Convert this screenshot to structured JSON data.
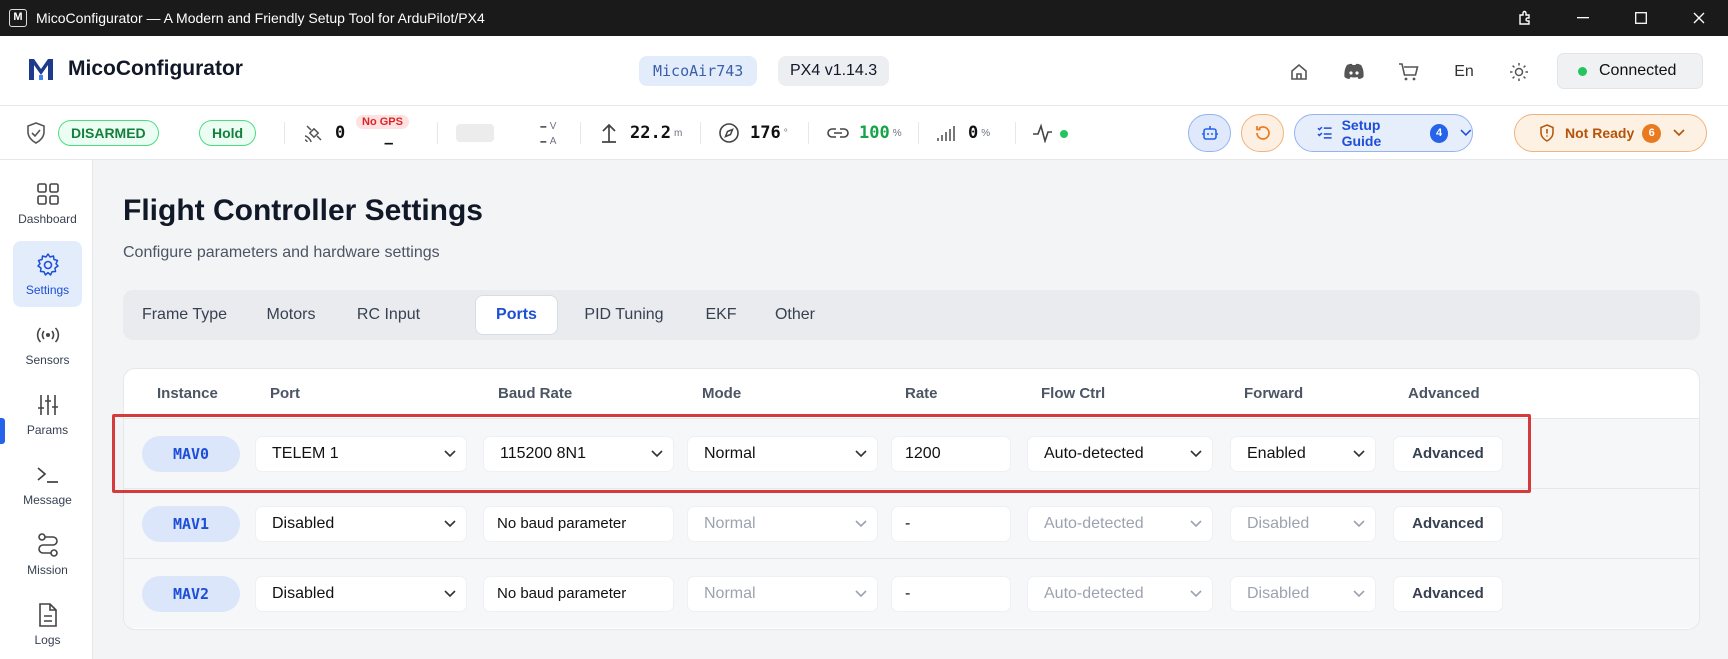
{
  "window": {
    "title": "MicoConfigurator — A Modern and Friendly Setup Tool for ArduPilot/PX4"
  },
  "header": {
    "app_name": "MicoConfigurator",
    "board": "MicoAir743",
    "firmware": "PX4 v1.14.3",
    "language": "En",
    "connection_status": "Connected",
    "icons": [
      "home-icon",
      "discord-icon",
      "cart-icon",
      "language",
      "theme-sun-icon"
    ]
  },
  "status": {
    "arm_state": "DISARMED",
    "flight_mode": "Hold",
    "satellites": "0",
    "gps_badge": "No GPS",
    "gps_fix": "–",
    "voltage": "–",
    "voltage_unit": "V",
    "current": "–",
    "current_unit": "A",
    "altitude": "22.2",
    "altitude_unit": "m",
    "heading": "176",
    "heading_unit": "°",
    "link_quality": "100",
    "link_unit": "%",
    "rssi": "0",
    "rssi_unit": "%",
    "setup_guide_label": "Setup Guide",
    "setup_guide_count": "4",
    "not_ready_label": "Not Ready",
    "not_ready_count": "6",
    "colors": {
      "armed_pill": "#15803d",
      "link_ok": "#16a34a",
      "warning": "#b45309",
      "accent": "#1d4ed8"
    }
  },
  "sidebar": {
    "items": [
      {
        "label": "Dashboard",
        "icon": "grid-icon"
      },
      {
        "label": "Settings",
        "icon": "gear-icon",
        "active": true
      },
      {
        "label": "Sensors",
        "icon": "radio-signal-icon"
      },
      {
        "label": "Params",
        "icon": "sliders-icon"
      },
      {
        "label": "Message",
        "icon": "terminal-icon"
      },
      {
        "label": "Mission",
        "icon": "route-icon"
      },
      {
        "label": "Logs",
        "icon": "document-icon"
      }
    ]
  },
  "main": {
    "title": "Flight Controller Settings",
    "subtitle": "Configure parameters and hardware settings",
    "tabs": [
      "Frame Type",
      "Motors",
      "RC Input",
      "Ports",
      "PID Tuning",
      "EKF",
      "Other"
    ],
    "active_tab": "Ports"
  },
  "ports_table": {
    "headers": [
      "Instance",
      "Port",
      "Baud Rate",
      "Mode",
      "Rate",
      "Flow Ctrl",
      "Forward",
      "Advanced"
    ],
    "rows": [
      {
        "instance": "MAV0",
        "port": "TELEM 1",
        "baud": "115200 8N1",
        "mode": "Normal",
        "rate": "1200",
        "flow": "Auto-detected",
        "forward": "Enabled",
        "advanced": "Advanced"
      },
      {
        "instance": "MAV1",
        "port": "Disabled",
        "baud": "No baud parameter",
        "mode": "Normal",
        "rate": "-",
        "flow": "Auto-detected",
        "forward": "Disabled",
        "advanced": "Advanced"
      },
      {
        "instance": "MAV2",
        "port": "Disabled",
        "baud": "No baud parameter",
        "mode": "Normal",
        "rate": "-",
        "flow": "Auto-detected",
        "forward": "Disabled",
        "advanced": "Advanced"
      }
    ]
  }
}
